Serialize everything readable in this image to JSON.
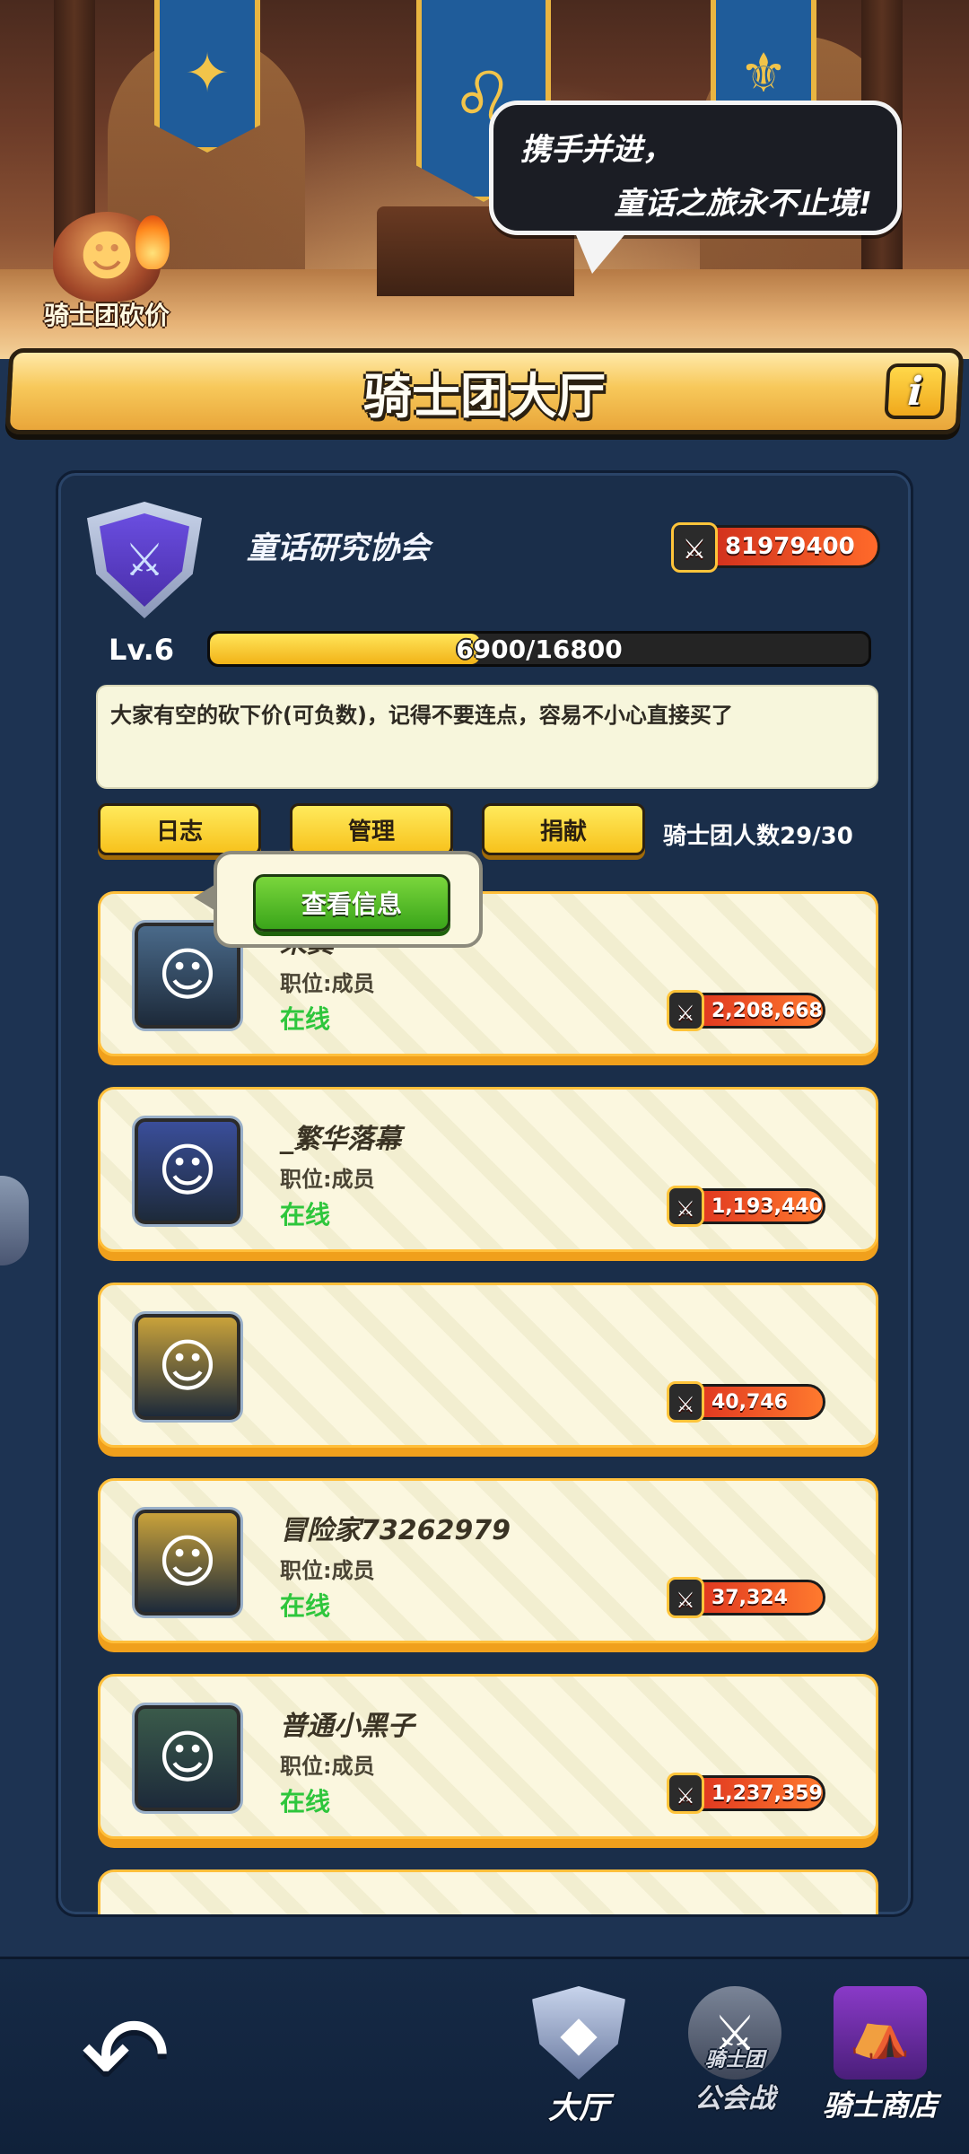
{
  "scene": {
    "speech_line1": "携手并进，",
    "speech_line2": "童话之旅永不止境!",
    "bargain_label": "骑士团砍价"
  },
  "header": {
    "title": "骑士团大厅",
    "info_glyph": "i"
  },
  "guild": {
    "name": "童话研究协会",
    "power": "81979400",
    "level": "Lv.6",
    "exp_text": "6900/16800",
    "exp_fraction": 0.4107,
    "notice": "大家有空的砍下价(可负数)，记得不要连点，容易不小心直接买了",
    "member_count": "骑士团人数29/30"
  },
  "actions": {
    "log": "日志",
    "manage": "管理",
    "donate": "捐献"
  },
  "members": [
    {
      "name": "来龚",
      "role": "职位:成员",
      "status": "在线",
      "power": "2,208,668",
      "avatar_color": "#4a6a8a"
    },
    {
      "name": "_繁华落幕",
      "role": "职位:成员",
      "status": "在线",
      "power": "1,193,440",
      "avatar_color": "#3a4e9a"
    },
    {
      "name": "",
      "role": "",
      "status": "",
      "power": "40,746",
      "avatar_color": "#c9a23a"
    },
    {
      "name": "冒险家73262979",
      "role": "职位:成员",
      "status": "在线",
      "power": "37,324",
      "avatar_color": "#c9a23a"
    },
    {
      "name": "普通小黑子",
      "role": "职位:成员",
      "status": "在线",
      "power": "1,237,359",
      "avatar_color": "#3a5a4a"
    }
  ],
  "popup": {
    "view_info": "查看信息"
  },
  "nav": {
    "hall": "大厅",
    "war": "公会战",
    "war_icon_text": "骑士团",
    "shop": "骑士商店"
  },
  "colors": {
    "accent_gold": "#f7c21c",
    "online_green": "#2ec63c",
    "power_red": "#d9291d",
    "panel_navy": "#1a2e4a"
  }
}
